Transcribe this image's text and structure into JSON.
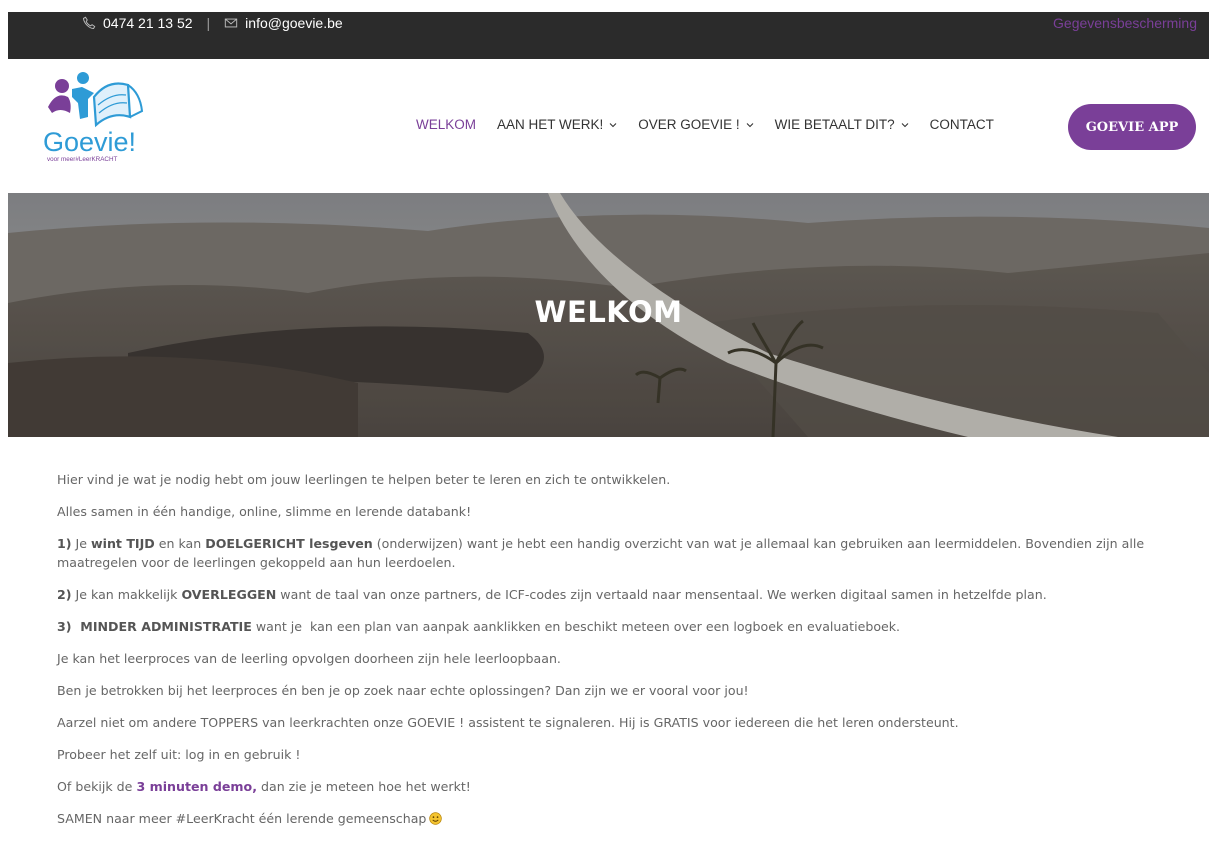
{
  "topbar": {
    "phone": "0474 21 13 52",
    "separator": "|",
    "email": "info@goevie.be",
    "privacy_link": "Gegevensbescherming",
    "icons": [
      "phone-icon",
      "envelope-icon"
    ]
  },
  "logo": {
    "name": "Goevie!",
    "tagline": "voor meer#LeerKRACHT"
  },
  "nav": {
    "items": [
      {
        "label": "WELKOM",
        "dropdown": false,
        "active": true
      },
      {
        "label": "AAN HET WERK!",
        "dropdown": true,
        "active": false
      },
      {
        "label": "OVER GOEVIE !",
        "dropdown": true,
        "active": false
      },
      {
        "label": "WIE BETAALT DIT?",
        "dropdown": true,
        "active": false
      },
      {
        "label": "CONTACT",
        "dropdown": false,
        "active": false
      }
    ],
    "app_button": "GOEVIE APP"
  },
  "hero": {
    "title": "WELKOM"
  },
  "content": {
    "p1": "Hier vind je wat je nodig hebt om jouw leerlingen te helpen beter te leren en zich te ontwikkelen.",
    "p2": "Alles samen in één handige, online, slimme en lerende databank!",
    "p3": {
      "num": "1)",
      "t1": " Je ",
      "b1": "wint TIJD",
      "t2": " en kan ",
      "b2": "DOELGERICHT lesgeven",
      "t3": " (onderwijzen) want je hebt een handig overzicht van wat je allemaal kan gebruiken aan leermiddelen. Bovendien zijn alle maatregelen voor de leerlingen gekoppeld aan hun leerdoelen."
    },
    "p4": {
      "num": "2)",
      "t1": " Je kan makkelijk ",
      "b1": "OVERLEGGEN",
      "t2": " want de taal van onze partners, de ICF-codes zijn vertaald naar mensentaal. We werken digitaal samen in hetzelfde plan."
    },
    "p5": {
      "num": "3)",
      "b1": "  MINDER ADMINISTRATIE",
      "t1": " want je  kan een plan van aanpak aanklikken en beschikt meteen over een logboek en evaluatieboek."
    },
    "p6": "Je kan het leerproces van de leerling opvolgen doorheen zijn hele leerloopbaan.",
    "p7": "Ben je betrokken bij het leerproces én ben je op zoek naar echte oplossingen? Dan zijn we er vooral voor jou!",
    "p8": "Aarzel niet om andere TOPPERS van leerkrachten onze GOEVIE ! assistent te signaleren. Hij is GRATIS voor iedereen die het leren ondersteunt.",
    "p9": "Probeer het zelf uit: log in en gebruik !",
    "p10": {
      "t1": "Of bekijk de ",
      "link": "3 minuten demo,",
      "t2": " dan zie je meteen hoe het werkt!"
    },
    "p11": "SAMEN naar meer #LeerKracht één lerende gemeenschap"
  },
  "colors": {
    "brand_purple": "#7a3f98",
    "topbar_bg": "#2b2b2b",
    "body_text": "#666666"
  }
}
